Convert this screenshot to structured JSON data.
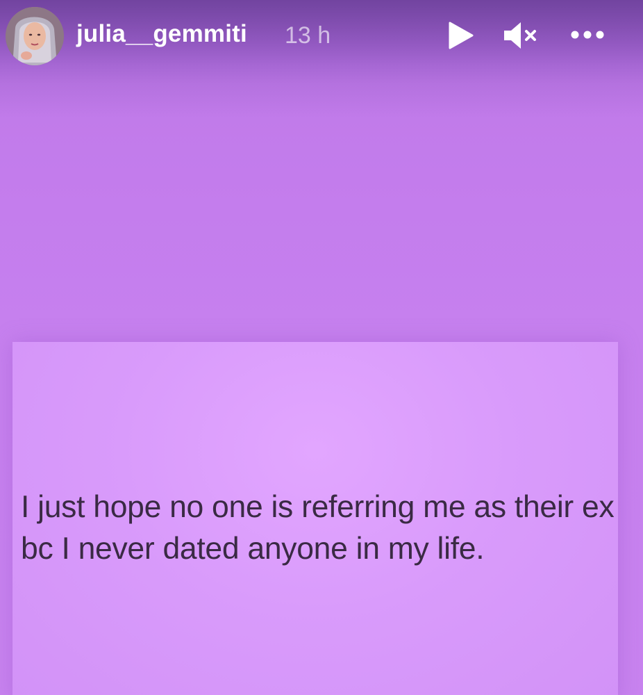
{
  "story": {
    "username": "julia__gemmiti",
    "timestamp": "13 h",
    "note_text": "I just hope no one is referring me as their ex bc I never dated anyone in my life."
  },
  "controls": {
    "play_icon": "play-icon",
    "mute_icon": "speaker-muted-icon",
    "more_icon": "more-options-icon"
  },
  "colors": {
    "background": "#c47ded",
    "card": "#d99bfb",
    "text": "#3a2a44"
  }
}
